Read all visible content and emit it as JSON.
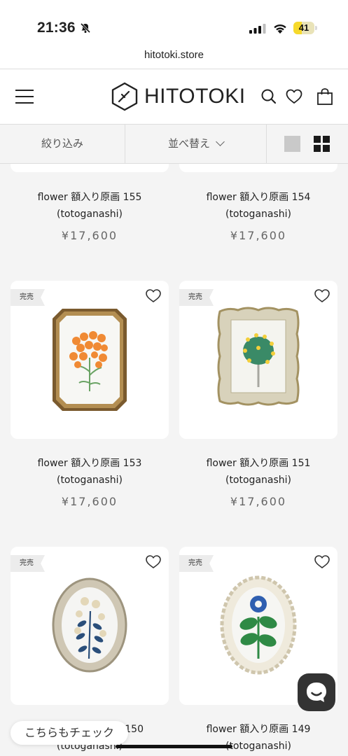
{
  "status": {
    "time": "21:36",
    "battery": "41",
    "battery_level": 0.41
  },
  "browser": {
    "url": "hitotoki.store"
  },
  "header": {
    "logo_text": "HITOTOKI",
    "icons": [
      "menu-icon",
      "search-icon",
      "heart-icon",
      "bag-icon"
    ]
  },
  "toolbar": {
    "filter_label": "絞り込み",
    "sort_label": "並べ替え"
  },
  "products": [
    {
      "name": "flower 額入り原画 155",
      "artist": "(totoganashi)",
      "price": "¥17,600"
    },
    {
      "name": "flower 額入り原画 154",
      "artist": "(totoganashi)",
      "price": "¥17,600"
    },
    {
      "name": "flower 額入り原画 153",
      "artist": "(totoganashi)",
      "price": "¥17,600",
      "badge": "完売"
    },
    {
      "name": "flower 額入り原画 151",
      "artist": "(totoganashi)",
      "price": "¥17,600",
      "badge": "完売"
    },
    {
      "name": "150",
      "artist": "(totoganashi)",
      "badge": "完売"
    },
    {
      "name": "flower 額入り原画 149",
      "artist": "(totoganashi)",
      "badge": "完売"
    }
  ],
  "floating": {
    "check_label": "こちらもチェック"
  },
  "colors": {
    "background": "#f4f4f4",
    "card": "#ffffff",
    "text": "#222222",
    "price": "#666666",
    "chat_button": "#333333"
  }
}
